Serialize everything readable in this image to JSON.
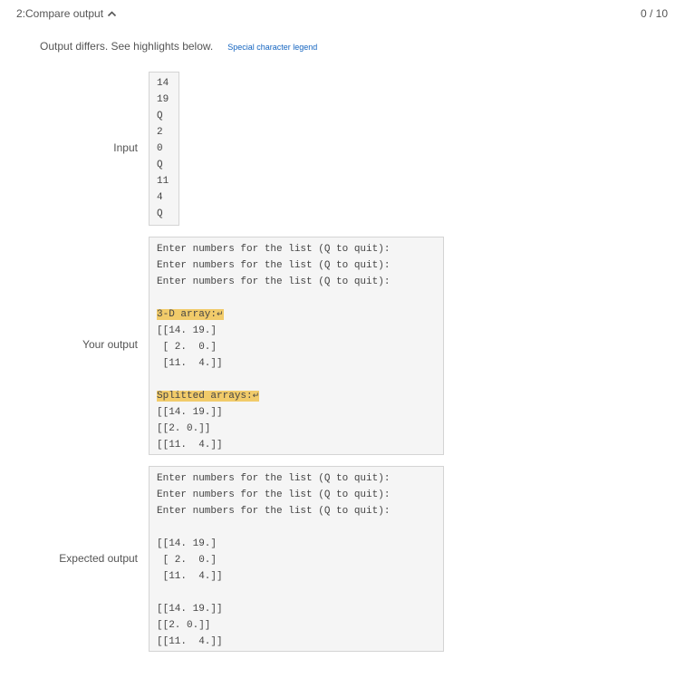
{
  "header": {
    "title": "2:Compare output",
    "score": "0 / 10"
  },
  "status": {
    "message": "Output differs. See highlights below.",
    "legend_link": "Special character legend"
  },
  "input": {
    "label": "Input",
    "lines": [
      "14",
      "19",
      "Q",
      "2",
      "0",
      "Q",
      "11",
      "4",
      "Q"
    ]
  },
  "your_output": {
    "label": "Your output",
    "lines": [
      "Enter numbers for the list (Q to quit):",
      "Enter numbers for the list (Q to quit):",
      "Enter numbers for the list (Q to quit):",
      "",
      "3-D array:",
      "[[14. 19.]",
      " [ 2.  0.]",
      " [11.  4.]]",
      "",
      "Splitted arrays:",
      "[[14. 19.]]",
      "[[2. 0.]]",
      "[[11.  4.]]"
    ],
    "newline_symbol": "↵"
  },
  "expected_output": {
    "label": "Expected output",
    "lines": [
      "Enter numbers for the list (Q to quit):",
      "Enter numbers for the list (Q to quit):",
      "Enter numbers for the list (Q to quit):",
      "",
      "[[14. 19.]",
      " [ 2.  0.]",
      " [11.  4.]]",
      "",
      "[[14. 19.]]",
      "[[2. 0.]]",
      "[[11.  4.]]"
    ]
  },
  "colors": {
    "highlight": "#f1cb6a",
    "link": "#1565c0",
    "box_background": "#f5f5f5",
    "box_border": "#d4d4d4"
  }
}
